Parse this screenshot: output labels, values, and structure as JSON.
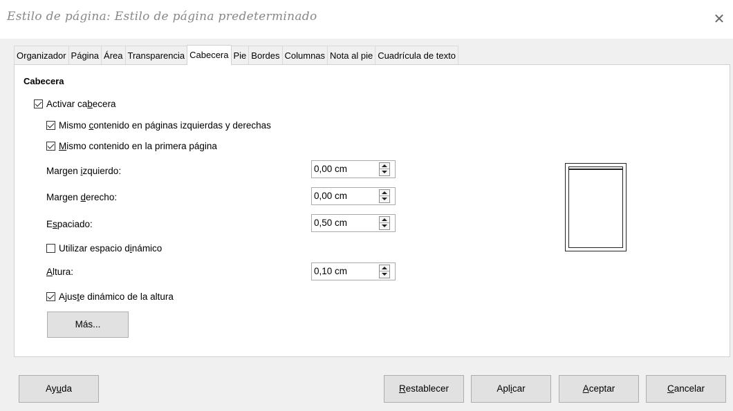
{
  "window": {
    "title": "Estilo de página: Estilo de página predeterminado",
    "close_glyph": "✕"
  },
  "tabs": [
    {
      "label": "Organizador",
      "active": false
    },
    {
      "label": "Página",
      "active": false
    },
    {
      "label": "Área",
      "active": false
    },
    {
      "label": "Transparencia",
      "active": false
    },
    {
      "label": "Cabecera",
      "active": true
    },
    {
      "label": "Pie",
      "active": false
    },
    {
      "label": "Bordes",
      "active": false
    },
    {
      "label": "Columnas",
      "active": false
    },
    {
      "label": "Nota al pie",
      "active": false
    },
    {
      "label": "Cuadrícula de texto",
      "active": false
    }
  ],
  "header_section": {
    "title": "Cabecera",
    "activate": {
      "pre": "Activar ca",
      "u": "b",
      "post": "ecera",
      "checked": true
    },
    "same_left_right": {
      "pre": "Mismo ",
      "u": "c",
      "post": "ontenido en páginas izquierdas y derechas",
      "checked": true
    },
    "same_first_page": {
      "pre": "",
      "u": "M",
      "post": "ismo contenido en la primera página",
      "checked": true
    },
    "left_margin": {
      "pre": "Margen ",
      "u": "i",
      "post": "zquierdo:",
      "value": "0,00 cm"
    },
    "right_margin": {
      "pre": "Margen ",
      "u": "d",
      "post": "erecho:",
      "value": "0,00 cm"
    },
    "spacing": {
      "pre": "E",
      "u": "s",
      "post": "paciado:",
      "value": "0,50 cm"
    },
    "dynamic_spacing": {
      "pre": "Utilizar espacio d",
      "u": "i",
      "post": "námico",
      "checked": false
    },
    "height": {
      "pre": "",
      "u": "A",
      "post": "ltura:",
      "value": "0,10 cm"
    },
    "autofit_height": {
      "pre": "Ajus",
      "u": "t",
      "post": "e dinámico de la altura",
      "checked": true
    },
    "more_label": "Más..."
  },
  "footer_buttons": {
    "help": {
      "pre": "Ay",
      "u": "u",
      "post": "da"
    },
    "reset": {
      "pre": "",
      "u": "R",
      "post": "establecer"
    },
    "apply": {
      "pre": "Apl",
      "u": "i",
      "post": "car"
    },
    "ok": {
      "pre": "",
      "u": "A",
      "post": "ceptar"
    },
    "cancel": {
      "pre": "",
      "u": "C",
      "post": "ancelar"
    }
  }
}
